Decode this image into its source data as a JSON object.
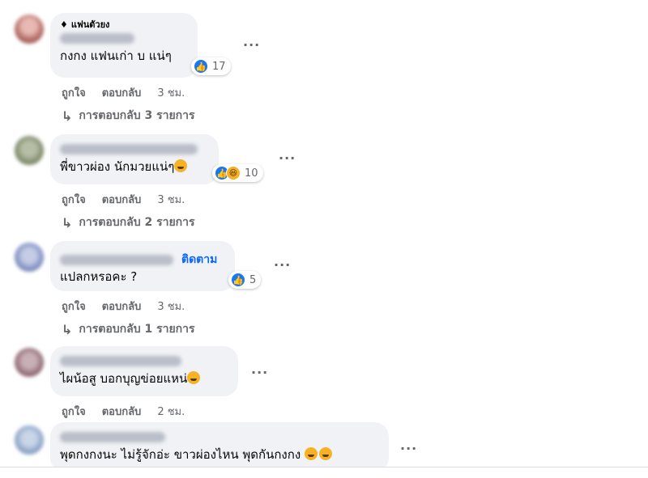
{
  "actions": {
    "like": "ถูกใจ",
    "reply": "ตอบกลับ"
  },
  "colors": {
    "bubble": "#f0f2f5",
    "like_blue": "#1877f2",
    "haha_yellow": "#f7b125",
    "link_blue": "#0866ff",
    "muted": "#65676b"
  },
  "comments": [
    {
      "badge": "แฟนตัวยง",
      "badge_icon": "diamond-icon",
      "text": "กงกง แฟนเก่า บ แน่ๆ",
      "reactions": [
        "like"
      ],
      "reaction_count": "17",
      "time": "3 ชม.",
      "replies": "การตอบกลับ 3 รายการ",
      "avatar_color": "#c98b87"
    },
    {
      "text": "พี่ขาวผ่อง นักมวยแน่ๆ",
      "text_emoji": "laughing-face",
      "reactions": [
        "like",
        "haha"
      ],
      "reaction_count": "10",
      "time": "3 ชม.",
      "replies": "การตอบกลับ 2 รายการ",
      "avatar_color": "#8d9a7a"
    },
    {
      "follow": "ติดตาม",
      "text": "แปลกหรอคะ ?",
      "reactions": [
        "like"
      ],
      "reaction_count": "5",
      "time": "3 ชม.",
      "replies": "การตอบกลับ 1 รายการ",
      "avatar_color": "#7c8fbf"
    },
    {
      "text": "ไผน้อสู บอกบุญข่อยแหน่",
      "text_emoji": "laughing-face",
      "time": "2 ชม.",
      "avatar_color": "#9a7e86"
    },
    {
      "text": "พุดกงกงนะ ไม่รู้จักอ่ะ ขาวผ่องไหน พุดกันกงกง",
      "text_emoji": "hand-over-mouth-face",
      "avatar_color": "#8fa7c8"
    }
  ]
}
